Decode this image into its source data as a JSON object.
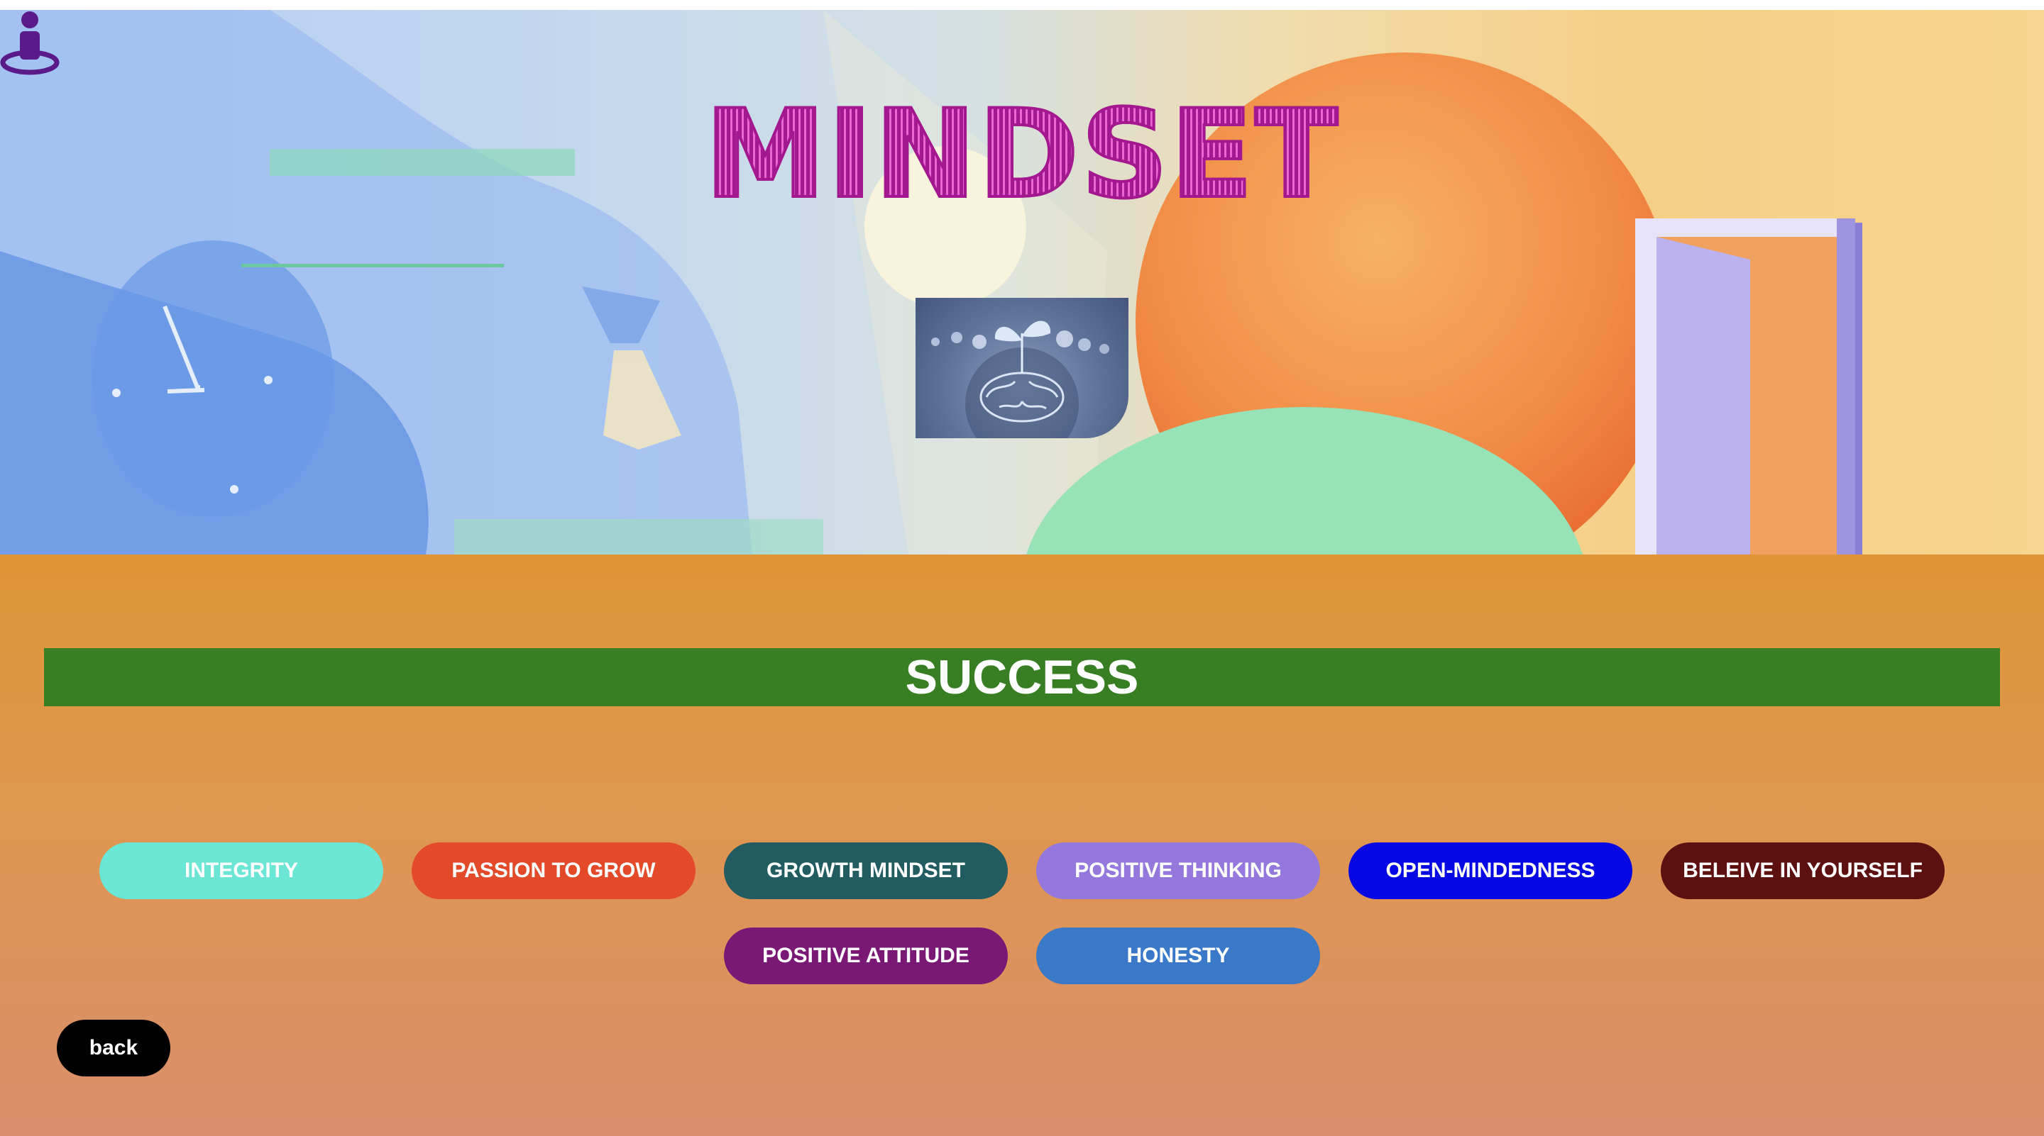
{
  "header": {
    "title": "MINDSET",
    "image_alt": "brain-sprout-illustration",
    "icon": "person-pin-icon"
  },
  "main": {
    "banner": "SUCCESS",
    "values": [
      {
        "label": "INTEGRITY",
        "color": "#6be6d5"
      },
      {
        "label": "PASSION TO GROW",
        "color": "#e24a29"
      },
      {
        "label": "GROWTH MINDSET",
        "color": "#215c61"
      },
      {
        "label": "POSITIVE THINKING",
        "color": "#9478db"
      },
      {
        "label": "OPEN-MINDEDNESS",
        "color": "#0508e2"
      },
      {
        "label": "BELEIVE IN YOURSELF",
        "color": "#5d1010"
      },
      {
        "label": "POSITIVE ATTITUDE",
        "color": "#7a1876"
      },
      {
        "label": "HONESTY",
        "color": "#3979c8"
      }
    ],
    "back_label": "back"
  },
  "colors": {
    "title": "#a21a8f",
    "banner": "#387e22",
    "accent_icon": "#5b1a8a",
    "main_bg_top": "#df9535",
    "main_bg_bottom": "#db8e6c"
  }
}
